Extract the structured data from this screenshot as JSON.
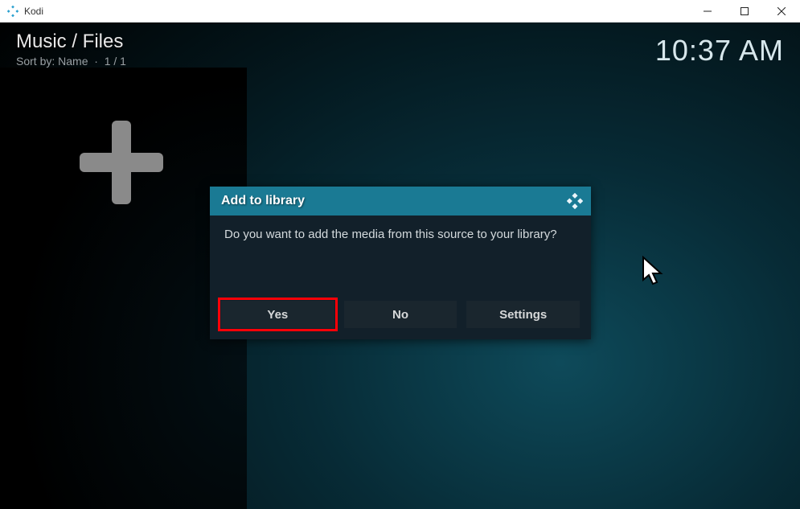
{
  "window": {
    "title": "Kodi"
  },
  "header": {
    "breadcrumb": "Music / Files",
    "sort_label": "Sort by: Name",
    "page_indicator": "1 / 1",
    "clock": "10:37 AM"
  },
  "dialog": {
    "title": "Add to library",
    "message": "Do you want to add the media from this source to your library?",
    "buttons": {
      "yes": "Yes",
      "no": "No",
      "settings": "Settings"
    }
  }
}
